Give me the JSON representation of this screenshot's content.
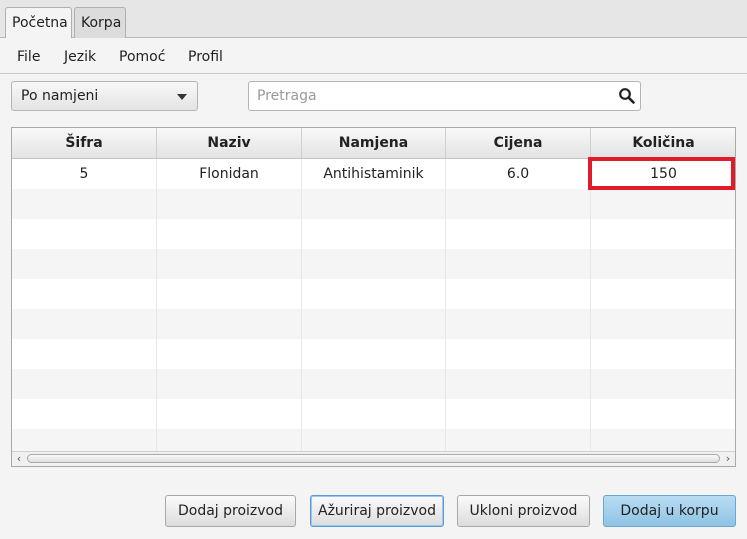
{
  "tabs": [
    {
      "label": "Početna",
      "active": true
    },
    {
      "label": "Korpa",
      "active": false
    }
  ],
  "menu": [
    "File",
    "Jezik",
    "Pomoć",
    "Profil"
  ],
  "filter": {
    "selected": "Po namjeni"
  },
  "search": {
    "placeholder": "Pretraga",
    "value": ""
  },
  "table": {
    "columns": [
      "Šifra",
      "Naziv",
      "Namjena",
      "Cijena",
      "Količina"
    ],
    "rows": [
      [
        "5",
        "Flonidan",
        "Antihistaminik",
        "6.0",
        "150"
      ]
    ]
  },
  "buttons": {
    "add": "Dodaj proizvod",
    "update": "Ažuriraj proizvod",
    "remove": "Ukloni proizvod",
    "add_to_cart": "Dodaj u korpu"
  },
  "colors": {
    "highlight": "#e21b2a",
    "accent_button": "#a6d0ec"
  }
}
